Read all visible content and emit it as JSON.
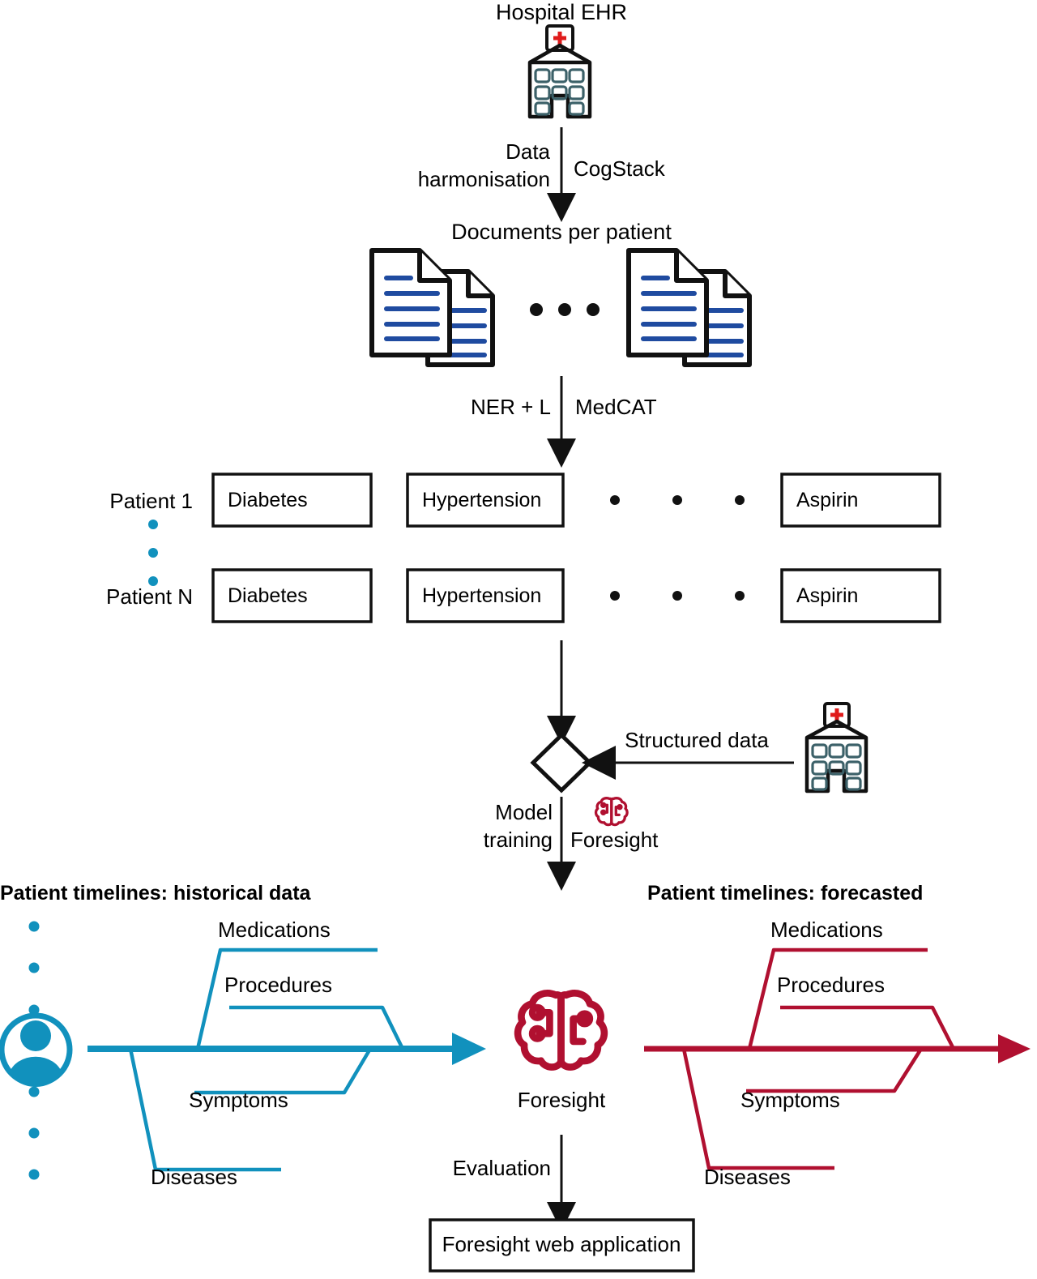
{
  "diagram": {
    "title_top": "Hospital EHR",
    "nodes": {
      "hospital_ehr": {
        "label": "Hospital EHR",
        "icon": "hospital-icon"
      },
      "documents": {
        "label": "Documents per patient",
        "icon": "documents-icon"
      },
      "merge": {
        "icon": "diamond-merge-node"
      },
      "hospital_structured": {
        "icon": "hospital-icon"
      },
      "foresight_brain": {
        "label": "Foresight",
        "icon": "brain-icon"
      },
      "web_app": {
        "label": "Foresight web application"
      }
    },
    "edges": [
      {
        "left": "Data",
        "left2": "harmonisation",
        "right": "CogStack"
      },
      {
        "left": "NER + L",
        "right": "MedCAT"
      },
      {
        "label": "Structured data"
      },
      {
        "left": "Model",
        "left2": "training",
        "right": "Foresight"
      },
      {
        "label": "Evaluation"
      }
    ],
    "edge_labels": {
      "data_harmonisation_1": "Data",
      "data_harmonisation_2": "harmonisation",
      "cogstack": "CogStack",
      "ner": "NER + L",
      "medcat": "MedCAT",
      "structured_data": "Structured data",
      "model_training_1": "Model",
      "model_training_2": "training",
      "foresight_edge": "Foresight",
      "evaluation": "Evaluation"
    },
    "patient_table": {
      "row_labels": [
        "Patient 1",
        "Patient N"
      ],
      "columns": [
        "Diabetes",
        "Hypertension",
        "Aspirin"
      ],
      "rows": [
        [
          "Diabetes",
          "Hypertension",
          "Aspirin"
        ],
        [
          "Diabetes",
          "Hypertension",
          "Aspirin"
        ]
      ],
      "ellipsis_dots": 3
    },
    "timelines": [
      {
        "id": "historical",
        "title": "Patient timelines: historical data",
        "color": "#1191bd",
        "tracks": [
          "Medications",
          "Procedures",
          "Symptoms",
          "Diseases"
        ]
      },
      {
        "id": "forecasted",
        "title": "Patient timelines: forecasted",
        "color": "#b01030",
        "tracks": [
          "Medications",
          "Procedures",
          "Symptoms",
          "Diseases"
        ]
      }
    ],
    "colors": {
      "teal": "#1191bd",
      "crimson": "#b01030",
      "doc_blue": "#1f4ba0",
      "hospital_window": "#3c6169",
      "cross_red": "#e01b1b",
      "ink": "#111111"
    }
  }
}
